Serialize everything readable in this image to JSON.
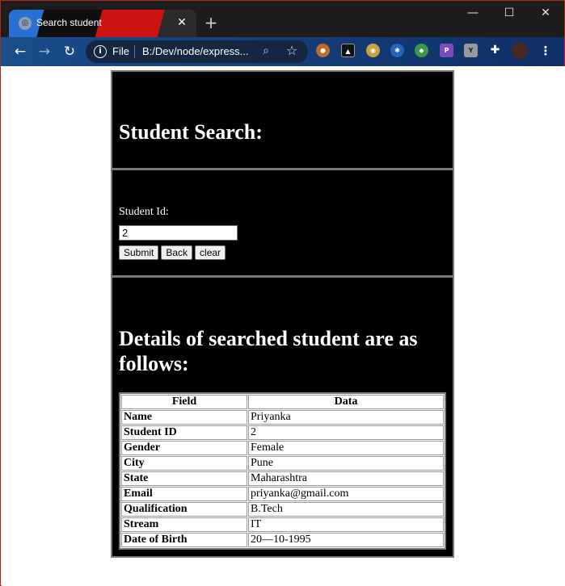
{
  "browser": {
    "tab_title": "Search student",
    "new_tab": "+",
    "window_controls": {
      "minimize": "—",
      "maximize": "☐",
      "close": "✕"
    },
    "nav": {
      "back": "←",
      "forward": "→",
      "reload": "↻"
    },
    "address": {
      "info_icon": "i",
      "scheme_label": "File",
      "url": "B:/Dev/node/express..."
    },
    "toolbar_icons": [
      "zoom-icon",
      "star-icon",
      "extension-icons",
      "puzzle-icon",
      "profile-avatar",
      "menu-icon"
    ]
  },
  "page": {
    "title": "Student Search:",
    "form": {
      "label": "Student Id:",
      "student_id_value": "2",
      "submit_label": "Submit",
      "back_label": "Back",
      "clear_label": "clear"
    },
    "results": {
      "heading": "Details of searched student are as follows:",
      "columns": [
        "Field",
        "Data"
      ],
      "rows": [
        {
          "field": "Name",
          "data": "Priyanka"
        },
        {
          "field": "Student ID",
          "data": "2"
        },
        {
          "field": "Gender",
          "data": "Female"
        },
        {
          "field": "City",
          "data": "Pune"
        },
        {
          "field": "State",
          "data": "Maharashtra"
        },
        {
          "field": "Email",
          "data": "priyanka@gmail.com"
        },
        {
          "field": "Qualification",
          "data": "B.Tech"
        },
        {
          "field": "Stream",
          "data": "IT"
        },
        {
          "field": "Date of Birth",
          "data": "20—10-1995"
        }
      ]
    }
  },
  "colors": {
    "panel_bg": "#000000",
    "panel_border": "#7a7a7a",
    "toolbar": "#1a4d8a"
  }
}
